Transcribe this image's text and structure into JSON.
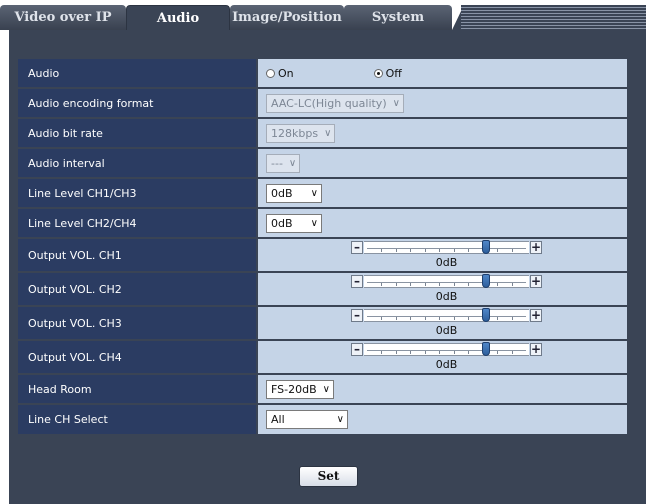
{
  "tabs": [
    {
      "label": "Video over IP",
      "active": false
    },
    {
      "label": "Audio",
      "active": true
    },
    {
      "label": "Image/Position",
      "active": false
    },
    {
      "label": "System",
      "active": false
    }
  ],
  "settings": {
    "audio": {
      "label": "Audio",
      "options": [
        "On",
        "Off"
      ],
      "selected": "Off"
    },
    "encoding": {
      "label": "Audio encoding format",
      "value": "AAC-LC(High quality)",
      "disabled": true
    },
    "bitrate": {
      "label": "Audio bit rate",
      "value": "128kbps",
      "disabled": true
    },
    "interval": {
      "label": "Audio interval",
      "value": "---",
      "disabled": true
    },
    "line_level_1": {
      "label": "Line Level CH1/CH3",
      "value": "0dB"
    },
    "line_level_2": {
      "label": "Line Level CH2/CH4",
      "value": "0dB"
    },
    "output_ch1": {
      "label": "Output VOL. CH1",
      "value": "0dB",
      "level": 0.75
    },
    "output_ch2": {
      "label": "Output VOL. CH2",
      "value": "0dB",
      "level": 0.75
    },
    "output_ch3": {
      "label": "Output VOL. CH3",
      "value": "0dB",
      "level": 0.75
    },
    "output_ch4": {
      "label": "Output VOL. CH4",
      "value": "0dB",
      "level": 0.75
    },
    "head_room": {
      "label": "Head Room",
      "value": "FS-20dB"
    },
    "line_ch_select": {
      "label": "Line CH Select",
      "value": "All"
    }
  },
  "set_button": {
    "label": "Set"
  },
  "colors": {
    "panel": "#3a4455",
    "label_bg": "#2b3c62",
    "value_bg": "#c5d4e7",
    "thumb": "#3b6fb0"
  }
}
